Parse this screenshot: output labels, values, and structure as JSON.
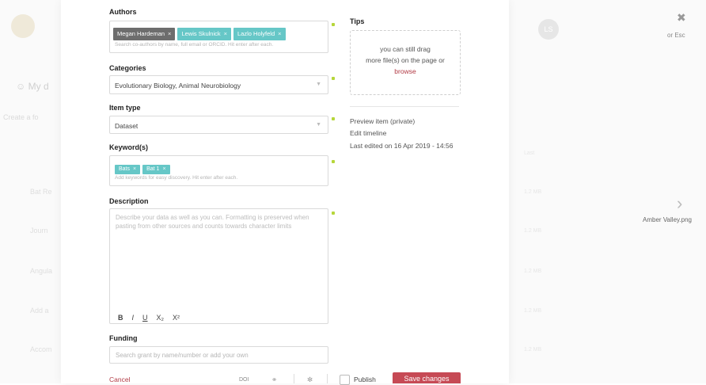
{
  "background": {
    "title": "My d",
    "subtitle": "Create a fo",
    "rows": [
      "Bat Re",
      "Journ",
      "Angula",
      "Add a",
      "Accom"
    ],
    "avatar": "LS",
    "right_cells": [
      "Last",
      "1.2 MB",
      "1.2 MB",
      "1.2 MB",
      "1.2 MB",
      "1.2 MB"
    ]
  },
  "overlay": {
    "close_hint": "or Esc",
    "next_file": "Amber Valley.png"
  },
  "form": {
    "authors": {
      "label": "Authors",
      "tags": [
        {
          "name": "Megan Hardeman",
          "style": "dark"
        },
        {
          "name": "Lewis Skulnick",
          "style": "teal"
        },
        {
          "name": "Lazlo Holyfeld",
          "style": "teal"
        }
      ],
      "remove_glyph": "×",
      "hint": "Search co-authors by name, full email or ORCID. Hit enter after each."
    },
    "categories": {
      "label": "Categories",
      "value": "Evolutionary Biology, Animal Neurobiology"
    },
    "item_type": {
      "label": "Item type",
      "value": "Dataset"
    },
    "keywords": {
      "label": "Keyword(s)",
      "tags": [
        "Bats",
        "Bat 1"
      ],
      "hint": "Add keywords for easy discovery. Hit enter after each."
    },
    "description": {
      "label": "Description",
      "placeholder": "Describe your data as well as you can. Formatting is preserved when pasting from other sources and counts towards character limits",
      "toolbar": [
        "B",
        "I",
        "U",
        "X₂",
        "X²"
      ]
    },
    "funding": {
      "label": "Funding",
      "placeholder": "Search grant by name/number or add your own"
    }
  },
  "tips": {
    "title": "Tips",
    "drop_line1": "you can still drag",
    "drop_line2": "more file(s) on the page or",
    "browse": "browse"
  },
  "side_info": {
    "preview": "Preview item (private)",
    "timeline": "Edit timeline",
    "last_edited": "Last edited on 16 Apr 2019 - 14:56"
  },
  "footer": {
    "cancel": "Cancel",
    "doi": "DOI",
    "publish": "Publish",
    "save": "Save changes"
  },
  "colors": {
    "teal_tag": "#66c7c7",
    "dark_tag": "#6d6d6d",
    "required_dot": "#b6d63a",
    "save_button": "#c64a55",
    "link": "#b23b45"
  }
}
